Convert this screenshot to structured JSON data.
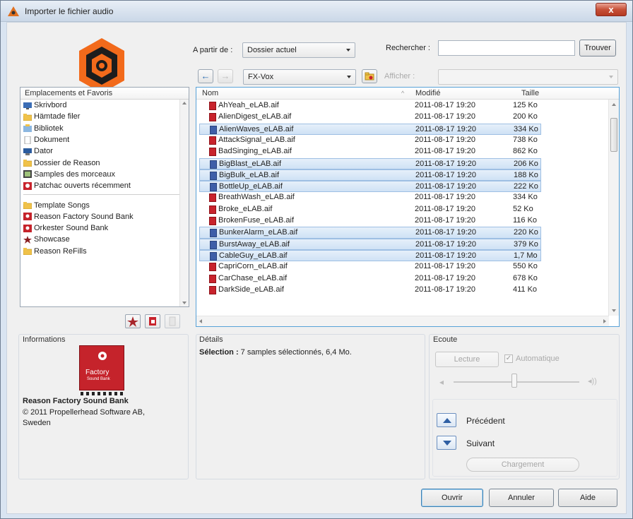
{
  "window": {
    "title": "Importer le fichier audio",
    "close_label": "x"
  },
  "top": {
    "from_label": "A partir de :",
    "from_value": "Dossier actuel",
    "search_label": "Rechercher :",
    "search_value": "",
    "find_button": "Trouver",
    "folder_value": "FX-Vox",
    "show_label": "Afficher :",
    "show_value": ""
  },
  "places": {
    "header": "Emplacements et Favoris",
    "items": [
      {
        "label": "Skrivbord",
        "icon": "desktop-icon"
      },
      {
        "label": "Hämtade filer",
        "icon": "folder-icon"
      },
      {
        "label": "Bibliotek",
        "icon": "library-icon"
      },
      {
        "label": "Dokument",
        "icon": "document-icon"
      },
      {
        "label": "Dator",
        "icon": "computer-icon"
      },
      {
        "label": "Dossier de Reason",
        "icon": "folder-icon"
      },
      {
        "label": "Samples des morceaux",
        "icon": "samples-icon"
      },
      {
        "label": "Patchac ouverts récemment",
        "icon": "recent-patch-icon"
      }
    ],
    "favorites": [
      {
        "label": "Template Songs",
        "icon": "folder-icon"
      },
      {
        "label": "Reason Factory Sound Bank",
        "icon": "soundbank-icon"
      },
      {
        "label": "Orkester Sound Bank",
        "icon": "soundbank-icon"
      },
      {
        "label": "Showcase",
        "icon": "star-icon"
      },
      {
        "label": "Reason ReFills",
        "icon": "folder-icon"
      }
    ]
  },
  "filelist": {
    "col_name": "Nom",
    "col_modified": "Modifié",
    "col_size": "Taille",
    "rows": [
      {
        "name": "AhYeah_eLAB.aif",
        "date": "2011-08-17 19:20",
        "size": "125 Ko",
        "selected": false
      },
      {
        "name": "AlienDigest_eLAB.aif",
        "date": "2011-08-17 19:20",
        "size": "200 Ko",
        "selected": false
      },
      {
        "name": "AlienWaves_eLAB.aif",
        "date": "2011-08-17 19:20",
        "size": "334 Ko",
        "selected": true
      },
      {
        "name": "AttackSignal_eLAB.aif",
        "date": "2011-08-17 19:20",
        "size": "738 Ko",
        "selected": false
      },
      {
        "name": "BadSinging_eLAB.aif",
        "date": "2011-08-17 19:20",
        "size": "862 Ko",
        "selected": false
      },
      {
        "name": "BigBlast_eLAB.aif",
        "date": "2011-08-17 19:20",
        "size": "206 Ko",
        "selected": true
      },
      {
        "name": "BigBulk_eLAB.aif",
        "date": "2011-08-17 19:20",
        "size": "188 Ko",
        "selected": true
      },
      {
        "name": "BottleUp_eLAB.aif",
        "date": "2011-08-17 19:20",
        "size": "222 Ko",
        "selected": true
      },
      {
        "name": "BreathWash_eLAB.aif",
        "date": "2011-08-17 19:20",
        "size": "334 Ko",
        "selected": false
      },
      {
        "name": "Broke_eLAB.aif",
        "date": "2011-08-17 19:20",
        "size": "52 Ko",
        "selected": false
      },
      {
        "name": "BrokenFuse_eLAB.aif",
        "date": "2011-08-17 19:20",
        "size": "116 Ko",
        "selected": false
      },
      {
        "name": "BunkerAlarm_eLAB.aif",
        "date": "2011-08-17 19:20",
        "size": "220 Ko",
        "selected": true
      },
      {
        "name": "BurstAway_eLAB.aif",
        "date": "2011-08-17 19:20",
        "size": "379 Ko",
        "selected": true
      },
      {
        "name": "CableGuy_eLAB.aif",
        "date": "2011-08-17 19:20",
        "size": "1,7 Mo",
        "selected": true
      },
      {
        "name": "CapriCorn_eLAB.aif",
        "date": "2011-08-17 19:20",
        "size": "550 Ko",
        "selected": false
      },
      {
        "name": "CarChase_eLAB.aif",
        "date": "2011-08-17 19:20",
        "size": "678 Ko",
        "selected": false
      },
      {
        "name": "DarkSide_eLAB.aif",
        "date": "2011-08-17 19:20",
        "size": "411 Ko",
        "selected": false
      }
    ]
  },
  "info": {
    "title": "Informations",
    "bank_logo_line1": "Factory",
    "bank_logo_line2": "Sound Bank",
    "bank_name": "Reason Factory Sound Bank",
    "copyright": "© 2011 Propellerhead Software AB, Sweden"
  },
  "details": {
    "title": "Détails",
    "selection_label": "Sélection :",
    "selection_text": " 7 samples sélectionnés, 6,4 Mo."
  },
  "listen": {
    "title": "Ecoute",
    "play_button": "Lecture",
    "auto_label": "Automatique",
    "auto_checked": true,
    "volume_level": 0.5,
    "previous_label": "Précédent",
    "next_label": "Suivant",
    "loading_label": "Chargement"
  },
  "footer": {
    "open_button": "Ouvrir",
    "cancel_button": "Annuler",
    "help_button": "Aide"
  },
  "colors": {
    "accent": "#58a2d8",
    "selection": "#cfe2f5",
    "file_icon": "#c8232c",
    "brand": "#f26a1b"
  }
}
